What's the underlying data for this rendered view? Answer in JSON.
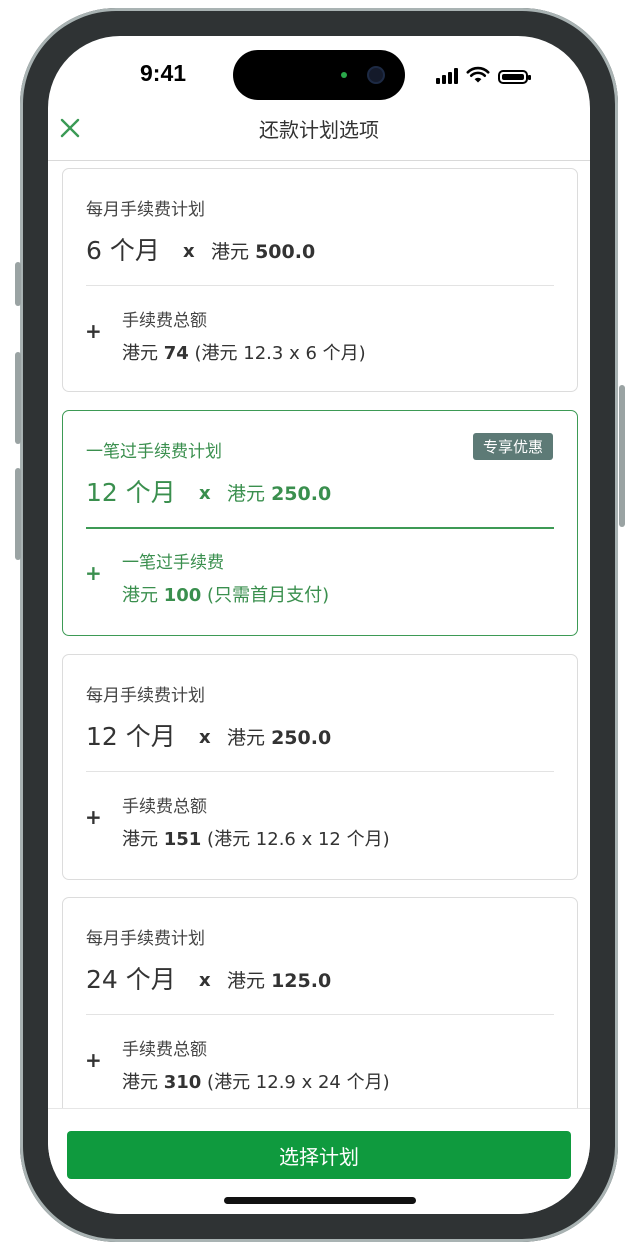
{
  "status": {
    "time": "9:41"
  },
  "header": {
    "title": "还款计划选项",
    "close_icon": "close-icon"
  },
  "colors": {
    "accent": "#0f9a3e",
    "selected": "#3a8f4e",
    "badge": "#5d7a76"
  },
  "plans": [
    {
      "plan_label": "每月手续费计划",
      "months": "6 个月",
      "x": "x",
      "currency": "港元",
      "amount": "500.0",
      "fee_label": "手续费总额",
      "fee_currency": "港元",
      "fee_amount": "74",
      "fee_detail": "(港元 12.3 x 6 个月)",
      "plus": "+"
    },
    {
      "plan_label": "一笔过手续费计划",
      "badge": "专享优惠",
      "months": "12 个月",
      "x": "x",
      "currency": "港元",
      "amount": "250.0",
      "fee_label": "一笔过手续费",
      "fee_currency": "港元",
      "fee_amount": "100",
      "fee_detail": "(只需首月支付)",
      "plus": "+",
      "selected": true
    },
    {
      "plan_label": "每月手续费计划",
      "months": "12 个月",
      "x": "x",
      "currency": "港元",
      "amount": "250.0",
      "fee_label": "手续费总额",
      "fee_currency": "港元",
      "fee_amount": "151",
      "fee_detail": "(港元 12.6 x 12 个月)",
      "plus": "+"
    },
    {
      "plan_label": "每月手续费计划",
      "months": "24 个月",
      "x": "x",
      "currency": "港元",
      "amount": "125.0",
      "fee_label": "手续费总额",
      "fee_currency": "港元",
      "fee_amount": "310",
      "fee_detail": "(港元 12.9 x 24 个月)",
      "plus": "+"
    }
  ],
  "footer": {
    "button_label": "选择计划"
  }
}
